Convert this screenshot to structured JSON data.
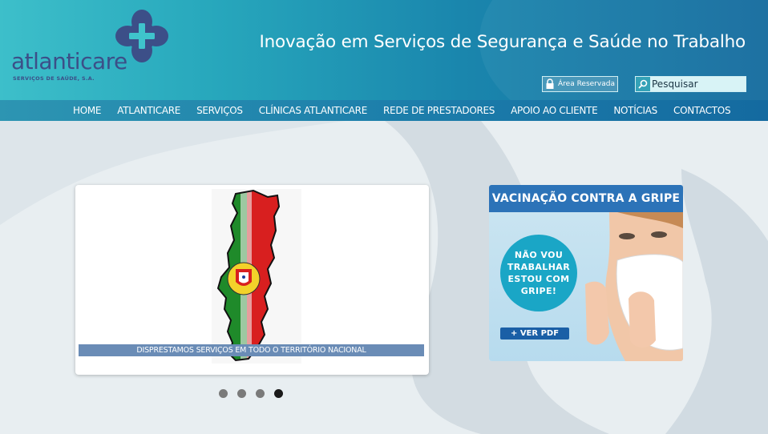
{
  "header": {
    "logo_text": "atlanticare",
    "logo_subtitle": "SERVIÇOS DE SAÚDE, S.A.",
    "tagline": "Inovação em Serviços de Segurança e Saúde no Trabalho",
    "reserved_area_label": "Área Reservada",
    "search_placeholder": "Pesquisar",
    "search_value": "Pesquisar"
  },
  "nav": {
    "items": [
      {
        "label": "HOME"
      },
      {
        "label": "ATLANTICARE"
      },
      {
        "label": "SERVIÇOS"
      },
      {
        "label": "CLÍNICAS ATLANTICARE"
      },
      {
        "label": "REDE DE PRESTADORES"
      },
      {
        "label": "APOIO AO CLIENTE"
      },
      {
        "label": "NOTÍCIAS"
      },
      {
        "label": "CONTACTOS"
      }
    ]
  },
  "slider": {
    "caption": "DISPRESTAMOS SERVIÇOS EM TODO O TERRITÓRIO NACIONAL",
    "slide_count": 4,
    "active_slide": 4
  },
  "banner": {
    "title": "VACINAÇÃO CONTRA A GRIPE",
    "bubble_text": "NÃO VOU TRABALHAR ESTOU COM GRIPE!",
    "button_label": "+ VER PDF"
  },
  "colors": {
    "logo": "#3c4f88",
    "nav": "#1d7fab",
    "banner_head": "#2c73b8",
    "bubble": "#1aa6c6",
    "caption_bar": "#6a8cb6"
  },
  "icons": {
    "lock": "lock-icon",
    "search": "search-icon",
    "logo_mark": "cross-flower-icon"
  }
}
